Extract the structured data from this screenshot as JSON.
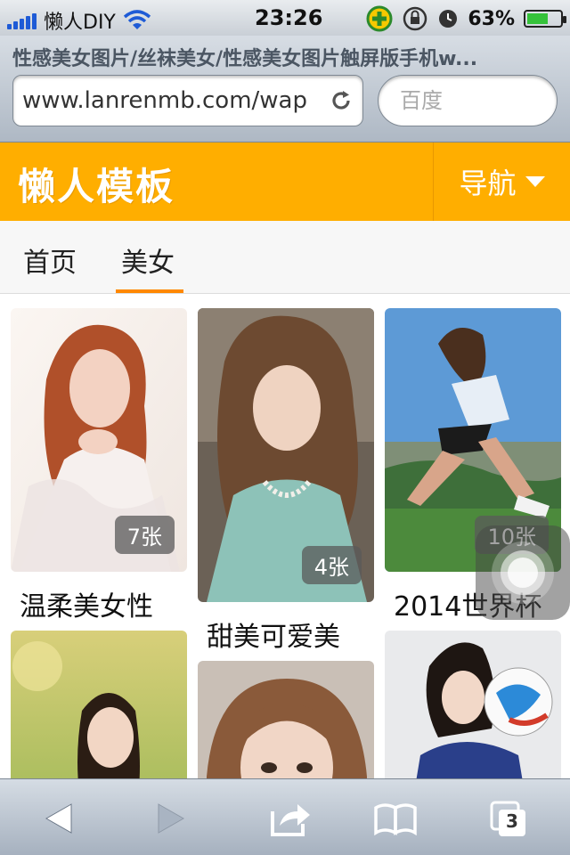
{
  "status_bar": {
    "carrier": "懒人DIY",
    "time": "23:26",
    "battery_percent": "63%",
    "battery_level": 0.63,
    "icons": [
      "signal-icon",
      "wifi-icon",
      "app-badge-icon",
      "rotation-lock-icon",
      "alarm-icon",
      "battery-icon"
    ]
  },
  "browser": {
    "page_title": "性感美女图片/丝袜美女/性感美女图片触屏版手机w...",
    "url": "www.lanrenmb.com/wap",
    "search_placeholder": "百度"
  },
  "header": {
    "logo": "懒人模板",
    "nav_label": "导航",
    "brand_color": "#ffae00"
  },
  "tabs": [
    {
      "label": "首页",
      "active": false
    },
    {
      "label": "美女",
      "active": true
    }
  ],
  "gallery": [
    {
      "title": "温柔美女性",
      "count": "7张"
    },
    {
      "title": "甜美可爱美",
      "count": "4张"
    },
    {
      "title": "2014世界杯",
      "count": "10张"
    },
    {
      "title": "",
      "count": ""
    },
    {
      "title": "",
      "count": ""
    },
    {
      "title": "",
      "count": ""
    }
  ],
  "toolbar": {
    "tabs_count": "3",
    "icons": [
      "back-icon",
      "forward-icon",
      "share-icon",
      "bookmarks-icon",
      "tabs-icon"
    ]
  }
}
